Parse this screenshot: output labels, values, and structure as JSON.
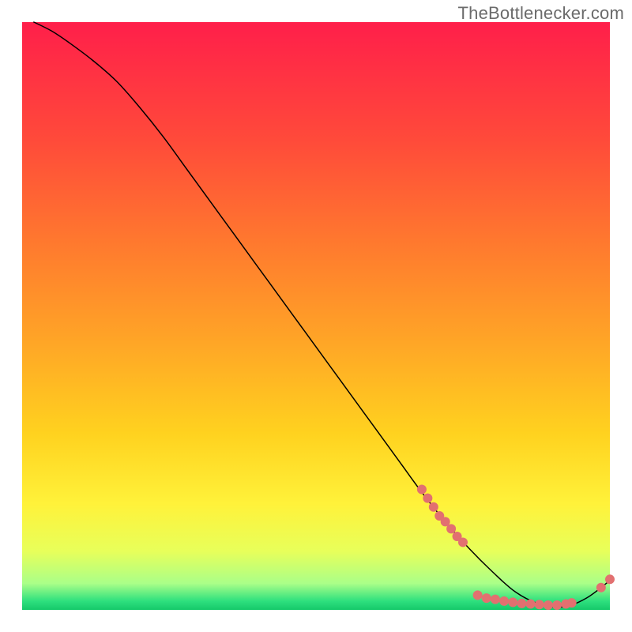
{
  "watermark": "TheBottlenecker.com",
  "chart_data": {
    "type": "line",
    "title": "",
    "xlabel": "",
    "ylabel": "",
    "xlim": [
      0,
      100
    ],
    "ylim": [
      0,
      100
    ],
    "grid": false,
    "legend": false,
    "series": [
      {
        "name": "curve",
        "x": [
          2,
          5,
          8,
          12,
          16,
          20,
          24,
          28,
          32,
          36,
          40,
          44,
          48,
          52,
          56,
          60,
          64,
          68,
          72,
          76,
          80,
          84,
          88,
          92,
          96,
          100
        ],
        "y": [
          100,
          98.5,
          96.5,
          93.5,
          90,
          85.5,
          80.5,
          75,
          69.5,
          64,
          58.5,
          53,
          47.5,
          42,
          36.5,
          31,
          25.5,
          20,
          15,
          10.5,
          6.5,
          3,
          1,
          0.5,
          2,
          5
        ]
      }
    ],
    "markers": [
      {
        "x": 68,
        "y": 20.5
      },
      {
        "x": 69,
        "y": 19
      },
      {
        "x": 70,
        "y": 17.5
      },
      {
        "x": 71,
        "y": 16
      },
      {
        "x": 72,
        "y": 15
      },
      {
        "x": 73,
        "y": 13.8
      },
      {
        "x": 74,
        "y": 12.5
      },
      {
        "x": 75,
        "y": 11.5
      },
      {
        "x": 77.5,
        "y": 2.5
      },
      {
        "x": 79,
        "y": 2
      },
      {
        "x": 80.5,
        "y": 1.8
      },
      {
        "x": 82,
        "y": 1.5
      },
      {
        "x": 83.5,
        "y": 1.3
      },
      {
        "x": 85,
        "y": 1.1
      },
      {
        "x": 86.5,
        "y": 1
      },
      {
        "x": 88,
        "y": 0.9
      },
      {
        "x": 89.5,
        "y": 0.8
      },
      {
        "x": 91,
        "y": 0.8
      },
      {
        "x": 92.5,
        "y": 1
      },
      {
        "x": 93.5,
        "y": 1.2
      },
      {
        "x": 98.5,
        "y": 3.8
      },
      {
        "x": 100,
        "y": 5.2
      }
    ],
    "marker_radius_px": 6
  },
  "gradient_stops": [
    {
      "offset": 0.0,
      "color": "#ff1f4a"
    },
    {
      "offset": 0.2,
      "color": "#ff4a3a"
    },
    {
      "offset": 0.38,
      "color": "#ff7a2e"
    },
    {
      "offset": 0.55,
      "color": "#ffa726"
    },
    {
      "offset": 0.7,
      "color": "#ffd21f"
    },
    {
      "offset": 0.82,
      "color": "#fff23a"
    },
    {
      "offset": 0.9,
      "color": "#e8ff5a"
    },
    {
      "offset": 0.955,
      "color": "#aaff88"
    },
    {
      "offset": 0.985,
      "color": "#2ee07e"
    },
    {
      "offset": 1.0,
      "color": "#15c96a"
    }
  ]
}
